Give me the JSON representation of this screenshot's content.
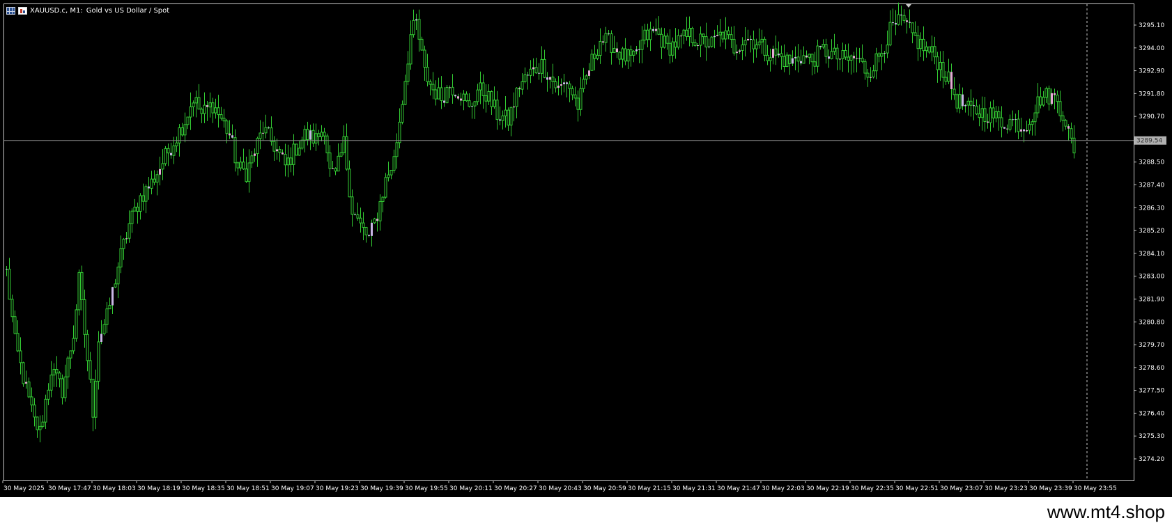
{
  "window": {
    "symbol": "XAUUSD.c, M1:",
    "description": "Gold vs US Dollar / Spot",
    "icons": [
      "chart-grid-icon",
      "candlestick-icon"
    ]
  },
  "watermark": "www.mt4.shop",
  "colors": {
    "background": "#000000",
    "frame": "#c8c8c8",
    "bull": "#33cc33",
    "bear": "#33cc33",
    "doji": "#c9b6e6",
    "doji_alt": "#e6a8d6",
    "bid_line": "#8c8c8c",
    "axis_text": "#ffffff",
    "price_label_bg": "#b0b0b0"
  },
  "chart_data": {
    "type": "candlestick",
    "symbol": "XAUUSD.c",
    "timeframe": "M1",
    "grid": false,
    "ylim": [
      3273.3,
      3296.0
    ],
    "y_ticks": [
      3295.1,
      3294.0,
      3292.9,
      3291.8,
      3290.7,
      3288.5,
      3287.4,
      3286.3,
      3285.2,
      3284.1,
      3283.0,
      3281.9,
      3280.8,
      3279.7,
      3278.6,
      3277.5,
      3276.4,
      3275.3,
      3274.2
    ],
    "y_tick_labels": [
      "3295.10",
      "3294.00",
      "3292.90",
      "3291.80",
      "3290.70",
      "3288.50",
      "3287.40",
      "3286.30",
      "3285.20",
      "3284.10",
      "3283.00",
      "3281.90",
      "3280.80",
      "3279.70",
      "3278.60",
      "3277.50",
      "3276.40",
      "3275.30",
      "3274.20"
    ],
    "current_price": 3289.54,
    "current_price_label": "3289.54",
    "x_tick_labels": [
      "30 May 2025",
      "30 May 17:47",
      "30 May 18:03",
      "30 May 18:19",
      "30 May 18:35",
      "30 May 18:51",
      "30 May 19:07",
      "30 May 19:23",
      "30 May 19:39",
      "30 May 19:55",
      "30 May 20:11",
      "30 May 20:27",
      "30 May 20:43",
      "30 May 20:59",
      "30 May 21:15",
      "30 May 21:31",
      "30 May 21:47",
      "30 May 22:03",
      "30 May 22:19",
      "30 May 22:35",
      "30 May 22:51",
      "30 May 23:07",
      "30 May 23:23",
      "30 May 23:39",
      "30 May 23:55"
    ],
    "bars_per_tick": 16,
    "close_path": [
      [
        0,
        3283.2
      ],
      [
        3,
        3279.8
      ],
      [
        8,
        3277.0
      ],
      [
        10,
        3276.0
      ],
      [
        12,
        3275.5
      ],
      [
        16,
        3278.5
      ],
      [
        20,
        3277.5
      ],
      [
        24,
        3280.2
      ],
      [
        26,
        3282.8
      ],
      [
        29,
        3279.0
      ],
      [
        31,
        3276.5
      ],
      [
        33,
        3280.0
      ],
      [
        36,
        3281.0
      ],
      [
        40,
        3283.5
      ],
      [
        44,
        3285.5
      ],
      [
        48,
        3286.8
      ],
      [
        52,
        3287.5
      ],
      [
        56,
        3288.5
      ],
      [
        60,
        3289.5
      ],
      [
        64,
        3290.5
      ],
      [
        67,
        3291.6
      ],
      [
        70,
        3290.8
      ],
      [
        74,
        3291.3
      ],
      [
        77,
        3290.6
      ],
      [
        80,
        3289.8
      ],
      [
        83,
        3288.2
      ],
      [
        86,
        3288.0
      ],
      [
        89,
        3289.0
      ],
      [
        92,
        3290.1
      ],
      [
        96,
        3289.3
      ],
      [
        100,
        3288.3
      ],
      [
        104,
        3289.2
      ],
      [
        107,
        3289.8
      ],
      [
        111,
        3289.6
      ],
      [
        114,
        3290.2
      ],
      [
        116,
        3288.0
      ],
      [
        118,
        3287.8
      ],
      [
        121,
        3289.4
      ],
      [
        124,
        3286.2
      ],
      [
        127,
        3285.4
      ],
      [
        130,
        3284.8
      ],
      [
        133,
        3286.0
      ],
      [
        136,
        3287.6
      ],
      [
        139,
        3288.6
      ],
      [
        142,
        3291.5
      ],
      [
        145,
        3294.6
      ],
      [
        147,
        3295.2
      ],
      [
        150,
        3292.8
      ],
      [
        153,
        3292.0
      ],
      [
        156,
        3291.6
      ],
      [
        159,
        3292.2
      ],
      [
        163,
        3291.8
      ],
      [
        166,
        3291.0
      ],
      [
        169,
        3292.0
      ],
      [
        172,
        3291.8
      ],
      [
        176,
        3290.8
      ],
      [
        180,
        3290.5
      ],
      [
        184,
        3292.2
      ],
      [
        188,
        3292.8
      ],
      [
        192,
        3293.2
      ],
      [
        195,
        3292.6
      ],
      [
        198,
        3292.0
      ],
      [
        201,
        3292.4
      ],
      [
        205,
        3291.2
      ],
      [
        209,
        3293.0
      ],
      [
        213,
        3294.4
      ],
      [
        217,
        3294.2
      ],
      [
        221,
        3293.6
      ],
      [
        225,
        3293.4
      ],
      [
        229,
        3294.5
      ],
      [
        233,
        3294.8
      ],
      [
        237,
        3294.0
      ],
      [
        241,
        3294.3
      ],
      [
        245,
        3294.6
      ],
      [
        249,
        3294.3
      ],
      [
        253,
        3294.2
      ],
      [
        257,
        3294.7
      ],
      [
        261,
        3294.0
      ],
      [
        265,
        3294.5
      ],
      [
        269,
        3294.3
      ],
      [
        273,
        3293.8
      ],
      [
        277,
        3293.6
      ],
      [
        281,
        3293.3
      ],
      [
        285,
        3293.6
      ],
      [
        289,
        3293.4
      ],
      [
        293,
        3293.9
      ],
      [
        297,
        3293.6
      ],
      [
        301,
        3293.4
      ],
      [
        305,
        3293.5
      ],
      [
        309,
        3292.8
      ],
      [
        313,
        3293.6
      ],
      [
        317,
        3294.8
      ],
      [
        321,
        3295.3
      ],
      [
        325,
        3294.6
      ],
      [
        329,
        3294.0
      ],
      [
        333,
        3293.6
      ],
      [
        337,
        3292.7
      ],
      [
        341,
        3291.5
      ],
      [
        345,
        3291.0
      ],
      [
        349,
        3290.9
      ],
      [
        353,
        3290.8
      ],
      [
        357,
        3290.4
      ],
      [
        361,
        3290.5
      ],
      [
        365,
        3290.2
      ],
      [
        368,
        3290.8
      ],
      [
        371,
        3291.6
      ],
      [
        374,
        3291.7
      ],
      [
        377,
        3291.5
      ],
      [
        380,
        3290.5
      ],
      [
        383,
        3288.8
      ]
    ],
    "ranges": [
      {
        "from": 0,
        "to": 42,
        "lo": 3273.5,
        "hi": 3290.0
      },
      {
        "from": 42,
        "to": 130,
        "lo": 3284.5,
        "hi": 3292.5
      },
      {
        "from": 130,
        "to": 300,
        "lo": 3289.9,
        "hi": 3295.7
      },
      {
        "from": 300,
        "to": 384,
        "lo": 3288.6,
        "hi": 3295.9
      }
    ],
    "future_marker_bar": 384
  }
}
